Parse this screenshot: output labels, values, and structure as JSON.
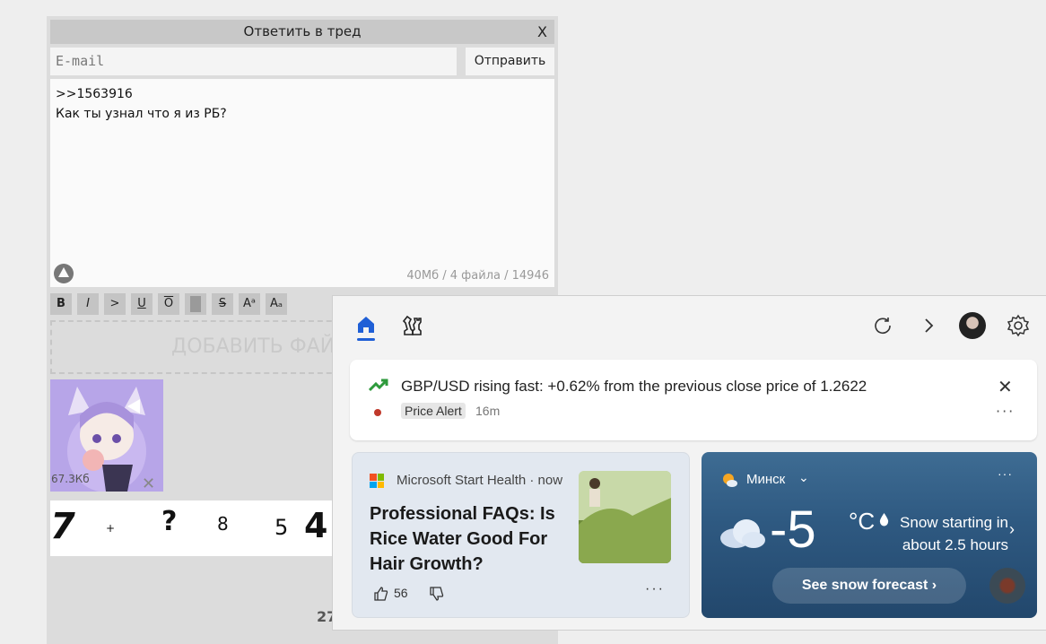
{
  "reply_form": {
    "title": "Ответить в тред",
    "close": "X",
    "email_placeholder": "E-mail",
    "send_label": "Отправить",
    "message": ">>1563916\nКак ты узнал что я из РБ?",
    "limits": "40Мб / 4 файла / 14946",
    "toolbar": [
      "B",
      "I",
      ">",
      "U",
      "O",
      "",
      "S",
      "Aᵃ",
      "Aₐ"
    ],
    "add_file_label": "ДОБАВИТЬ ФАЙ",
    "attachment": {
      "size": "67.3Кб",
      "remove": "✕"
    },
    "captcha": [
      "7",
      "+",
      "?",
      "8",
      "5",
      "4"
    ],
    "counter": "27"
  },
  "panel": {
    "alert": {
      "text": "GBP/USD rising fast: +0.62% from the previous close price of 1.2622",
      "badge": "Price Alert",
      "time": "16m",
      "close": "✕",
      "more": "···"
    },
    "news": {
      "source": "Microsoft Start Health · now",
      "title": "Professional FAQs: Is Rice Water Good For Hair Growth?",
      "likes": "56",
      "more": "···"
    },
    "weather": {
      "city": "Минск",
      "temperature": "-5",
      "unit": "°C",
      "description": "Snow starting in about 2.5 hours",
      "forecast_button": "See snow forecast",
      "more": "···"
    }
  },
  "colors": {
    "accent": "#1f5fd6",
    "weather_bg": "#2f5a82",
    "trend": "#2e9a3c"
  }
}
